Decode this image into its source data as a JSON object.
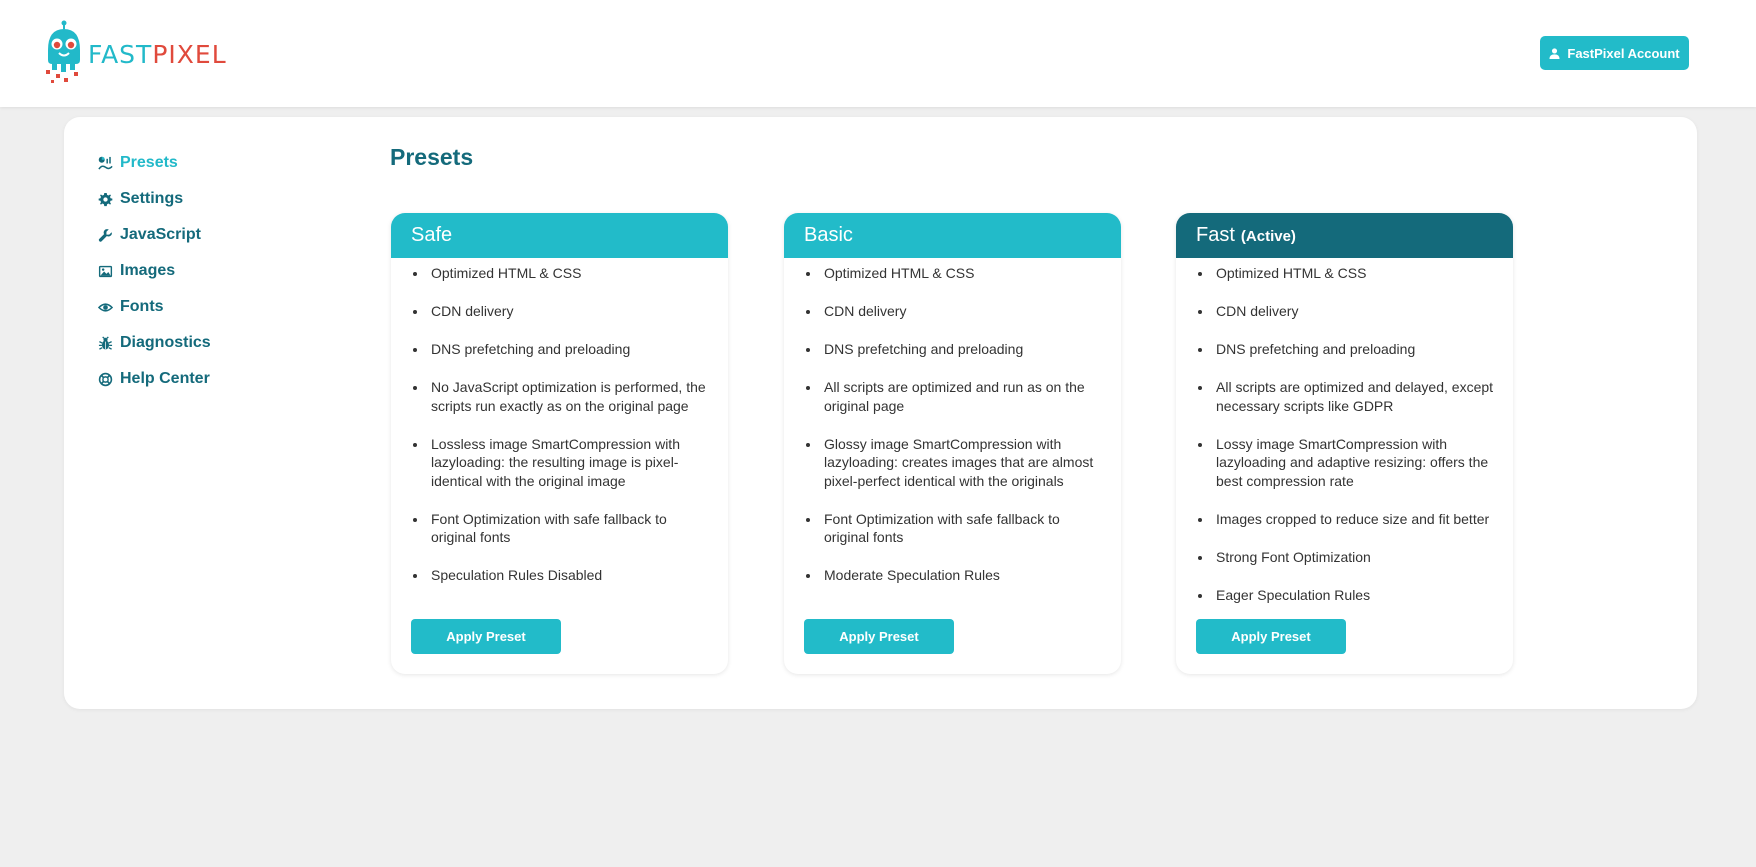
{
  "header": {
    "logo": {
      "text_part1": "FAST",
      "text_part2": "PIXEL",
      "icon": "robot-logo-icon"
    },
    "account_button": {
      "label": "FastPixel Account",
      "icon": "user-icon"
    }
  },
  "sidebar": {
    "items": [
      {
        "label": "Presets",
        "icon": "presets-chart-icon",
        "active": true
      },
      {
        "label": "Settings",
        "icon": "gear-icon",
        "active": false
      },
      {
        "label": "JavaScript",
        "icon": "wrench-icon",
        "active": false
      },
      {
        "label": "Images",
        "icon": "image-icon",
        "active": false
      },
      {
        "label": "Fonts",
        "icon": "eye-icon",
        "active": false
      },
      {
        "label": "Diagnostics",
        "icon": "bug-icon",
        "active": false
      },
      {
        "label": "Help Center",
        "icon": "lifebuoy-icon",
        "active": false
      }
    ]
  },
  "main": {
    "title": "Presets",
    "presets": [
      {
        "name": "Safe",
        "badge": "",
        "active": false,
        "features": [
          "Optimized HTML & CSS",
          "CDN delivery",
          "DNS prefetching and preloading",
          "No JavaScript optimization is performed, the scripts run exactly as on the original page",
          "Lossless image SmartCompression with lazyloading: the resulting image is pixel-identical with the original image",
          "Font Optimization with safe fallback to original fonts",
          "Speculation Rules Disabled"
        ],
        "button_label": "Apply Preset"
      },
      {
        "name": "Basic",
        "badge": "",
        "active": false,
        "features": [
          "Optimized HTML & CSS",
          "CDN delivery",
          "DNS prefetching and preloading",
          "All scripts are optimized and run as on the original page",
          "Glossy image SmartCompression with lazyloading: creates images that are almost pixel-perfect identical with the originals",
          "Font Optimization with safe fallback to original fonts",
          "Moderate Speculation Rules"
        ],
        "button_label": "Apply Preset"
      },
      {
        "name": "Fast",
        "badge": "(Active)",
        "active": true,
        "features": [
          "Optimized HTML & CSS",
          "CDN delivery",
          "DNS prefetching and preloading",
          "All scripts are optimized and delayed, except necessary scripts like GDPR",
          "Lossy image SmartCompression with lazyloading and adaptive resizing: offers the best compression rate",
          "Images cropped to reduce size and fit better",
          "Strong Font Optimization",
          "Eager Speculation Rules"
        ],
        "button_label": "Apply Preset"
      }
    ]
  },
  "colors": {
    "accent": "#22bbc9",
    "accent_dark": "#146a7b",
    "logo_red": "#e04a3c",
    "background": "#efefef"
  }
}
